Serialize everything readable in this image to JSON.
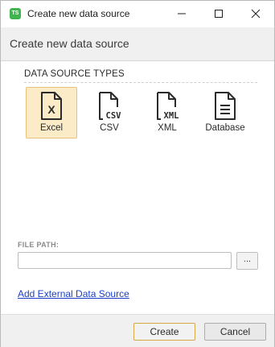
{
  "window": {
    "title": "Create new data source",
    "app_icon_text": "TS",
    "app_icon_color": "#3fb44f"
  },
  "header": {
    "title": "Create new data source"
  },
  "types": {
    "section_title": "DATA SOURCE TYPES",
    "selected": "Excel",
    "selected_bg": "#fbecc7",
    "items": [
      {
        "label": "Excel",
        "icon": "excel-file-icon"
      },
      {
        "label": "CSV",
        "icon": "csv-file-icon"
      },
      {
        "label": "XML",
        "icon": "xml-file-icon"
      },
      {
        "label": "Database",
        "icon": "database-file-icon"
      }
    ]
  },
  "file_path": {
    "label": "FILE PATH:",
    "value": "",
    "browse_label": "..."
  },
  "links": {
    "add_external": "Add External Data Source"
  },
  "footer": {
    "create_label": "Create",
    "cancel_label": "Cancel"
  }
}
